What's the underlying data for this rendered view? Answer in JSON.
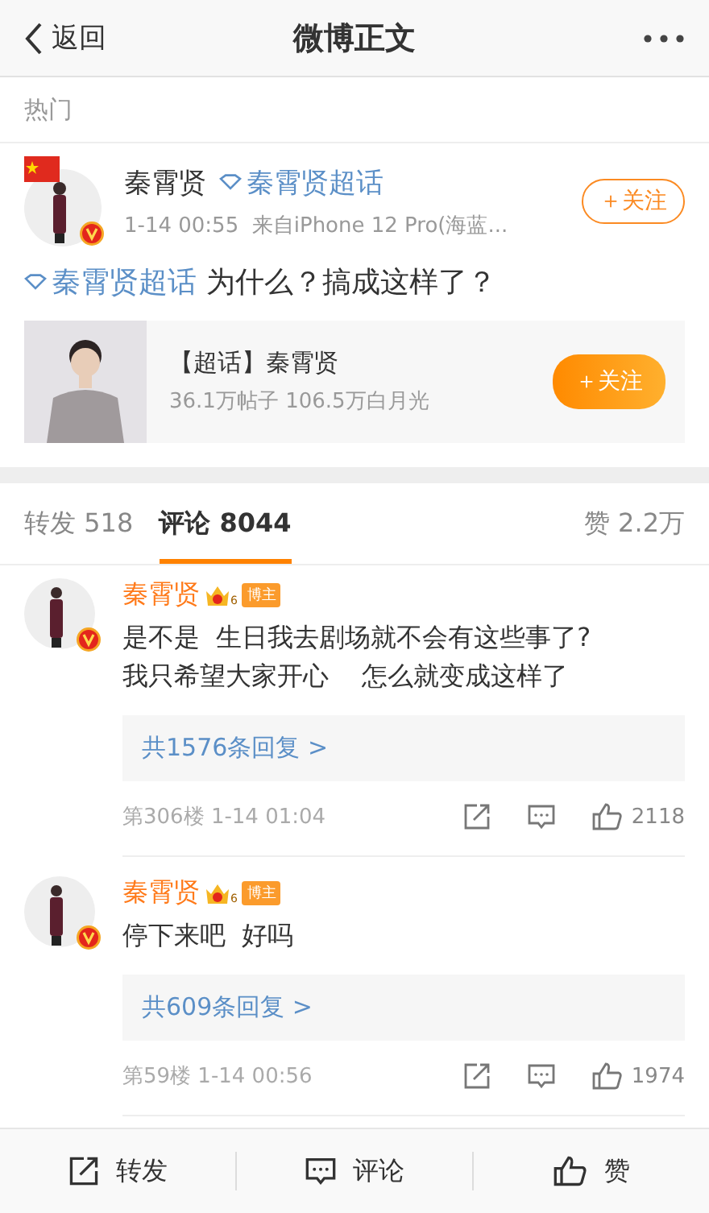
{
  "header": {
    "back_label": "返回",
    "title": "微博正文"
  },
  "section_label": "热门",
  "post": {
    "author": "秦霄贤",
    "author_topic": "秦霄贤超话",
    "time": "1-14 00:55",
    "source": "来自iPhone 12 Pro(海蓝...",
    "follow_label": "＋关注",
    "verified": true,
    "topic": "秦霄贤超话",
    "text": "为什么？搞成这样了？",
    "card": {
      "title": "【超话】秦霄贤",
      "stats": "36.1万帖子 106.5万白月光",
      "follow_label": "＋关注"
    }
  },
  "tabs": [
    {
      "label": "转发",
      "count": "518",
      "selected": false
    },
    {
      "label": "评论",
      "count": "8044",
      "selected": true
    },
    {
      "label": "赞",
      "count": "2.2万",
      "selected": false
    }
  ],
  "comments": [
    {
      "name": "秦霄贤",
      "level": "6",
      "badge": "博主",
      "verified": true,
      "text": "是不是  生日我去剧场就不会有这些事了?\n我只希望大家开心    怎么就变成这样了",
      "replies": "共1576条回复 >",
      "floor": "第306楼",
      "time": "1-14 01:04",
      "likes": "2118"
    },
    {
      "name": "秦霄贤",
      "level": "6",
      "badge": "博主",
      "verified": true,
      "text": "停下来吧  好吗",
      "replies": "共609条回复 >",
      "floor": "第59楼",
      "time": "1-14 00:56",
      "likes": "1974"
    }
  ],
  "bottom_bar": [
    {
      "kind": "repost",
      "label": "转发"
    },
    {
      "kind": "comment",
      "label": "评论"
    },
    {
      "kind": "like",
      "label": "赞"
    }
  ]
}
